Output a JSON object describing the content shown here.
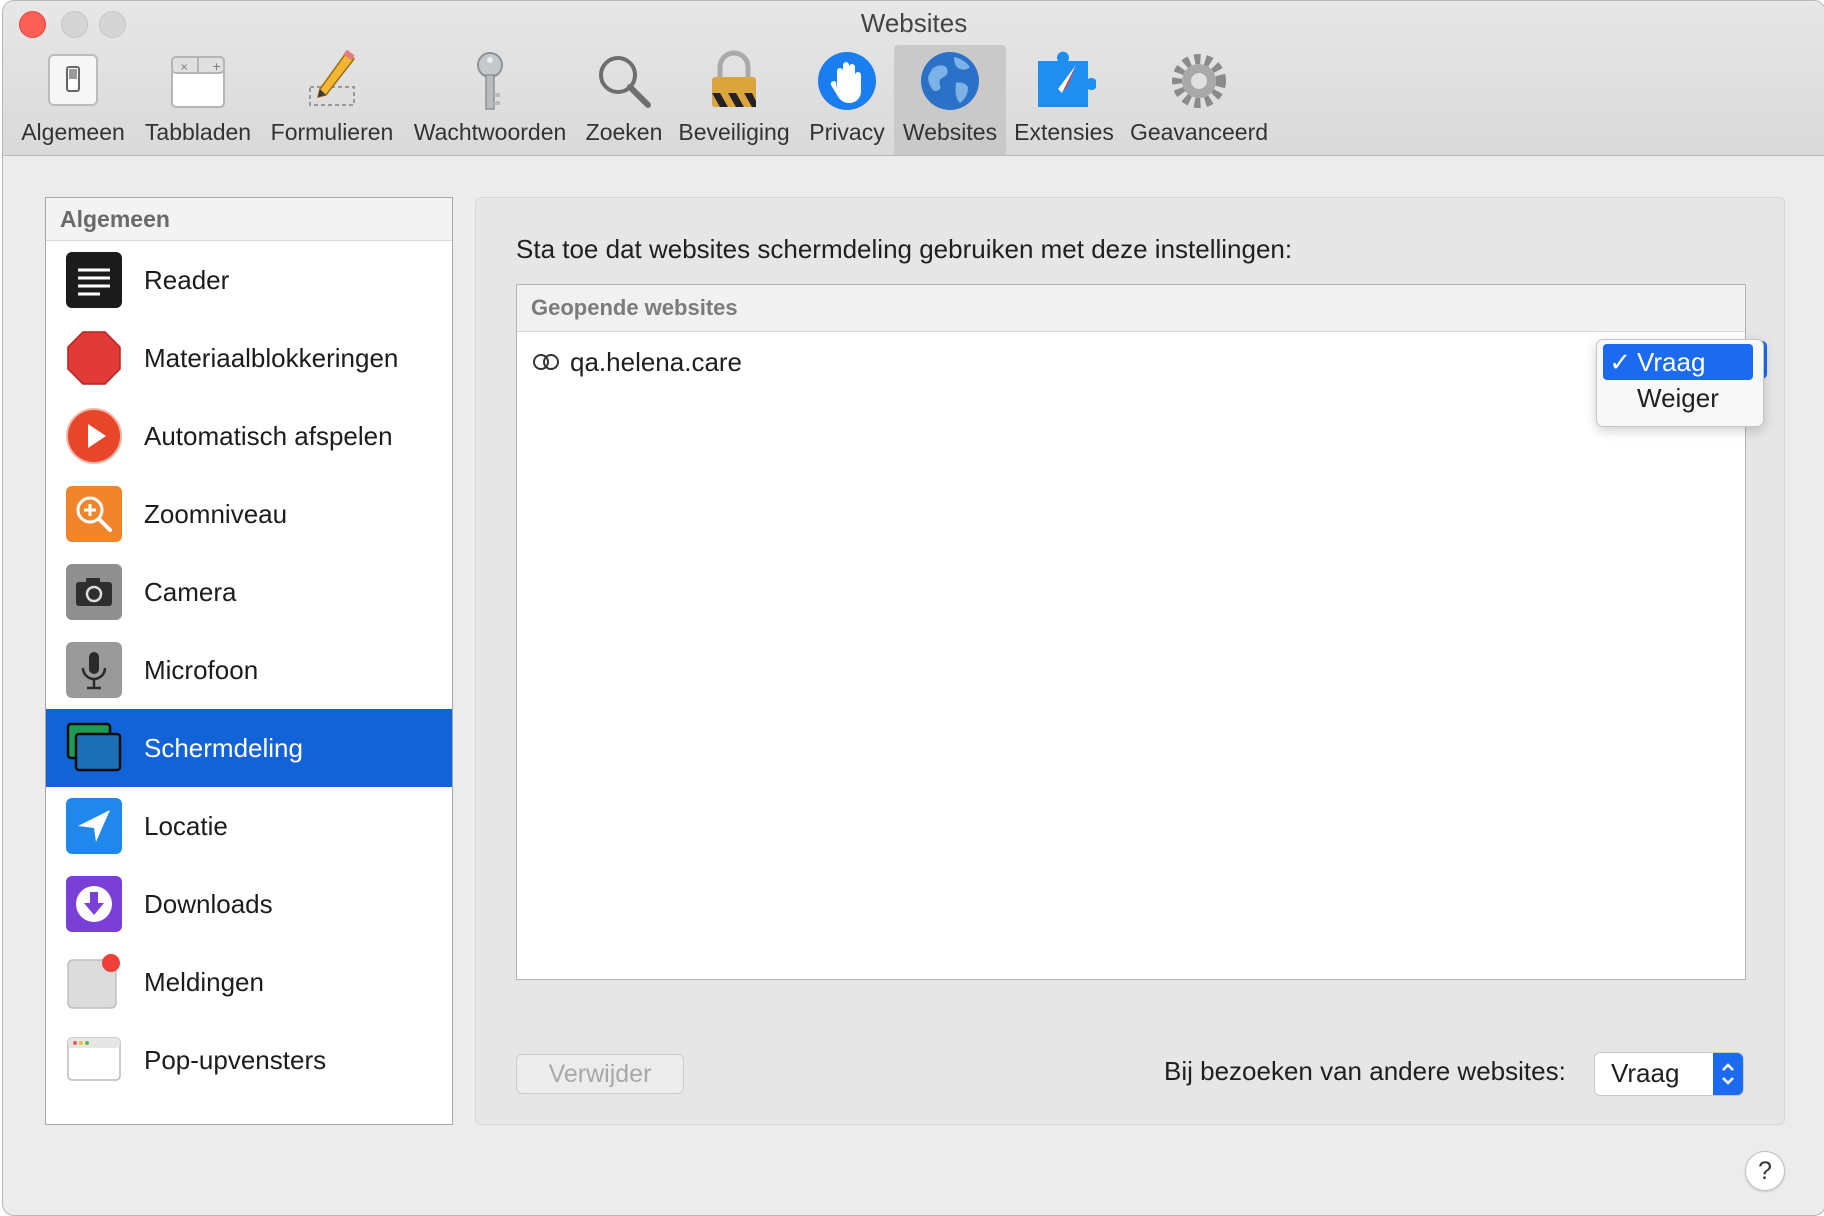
{
  "window": {
    "title": "Websites"
  },
  "toolbar": {
    "items": [
      {
        "label": "Algemeen",
        "icon": "switch-icon"
      },
      {
        "label": "Tabbladen",
        "icon": "tabs-icon"
      },
      {
        "label": "Formulieren",
        "icon": "pencil-icon"
      },
      {
        "label": "Wachtwoorden",
        "icon": "key-icon"
      },
      {
        "label": "Zoeken",
        "icon": "magnifier-icon"
      },
      {
        "label": "Beveiliging",
        "icon": "lock-icon"
      },
      {
        "label": "Privacy",
        "icon": "hand-icon"
      },
      {
        "label": "Websites",
        "icon": "globe-icon",
        "active": true
      },
      {
        "label": "Extensies",
        "icon": "puzzle-icon"
      },
      {
        "label": "Geavanceerd",
        "icon": "gear-icon"
      }
    ]
  },
  "sidebar": {
    "header": "Algemeen",
    "items": [
      {
        "label": "Reader",
        "icon": "reader-icon"
      },
      {
        "label": "Materiaalblokkeringen",
        "icon": "stop-sign-icon"
      },
      {
        "label": "Automatisch afspelen",
        "icon": "play-icon"
      },
      {
        "label": "Zoomniveau",
        "icon": "zoom-icon"
      },
      {
        "label": "Camera",
        "icon": "camera-icon"
      },
      {
        "label": "Microfoon",
        "icon": "microphone-icon"
      },
      {
        "label": "Schermdeling",
        "icon": "screen-sharing-icon",
        "selected": true
      },
      {
        "label": "Locatie",
        "icon": "location-icon"
      },
      {
        "label": "Downloads",
        "icon": "download-icon"
      },
      {
        "label": "Meldingen",
        "icon": "notifications-icon"
      },
      {
        "label": "Pop-upvensters",
        "icon": "popup-window-icon"
      }
    ]
  },
  "main": {
    "intro": "Sta toe dat websites schermdeling gebruiken met deze instellingen:",
    "table_header": "Geopende websites",
    "rows": [
      {
        "domain": "qa.helena.care",
        "setting": "Vraag"
      }
    ],
    "dropdown": {
      "options": [
        "Vraag",
        "Weiger"
      ],
      "selected": "Vraag",
      "checkmark": "✓"
    },
    "remove_button": "Verwijder",
    "other_sites_label": "Bij bezoeken van andere websites:",
    "other_sites_value": "Vraag"
  },
  "help": {
    "label": "?"
  },
  "colors": {
    "accent": "#1b6af0",
    "selection": "#1363d8",
    "close_button": "#fe5f57"
  }
}
